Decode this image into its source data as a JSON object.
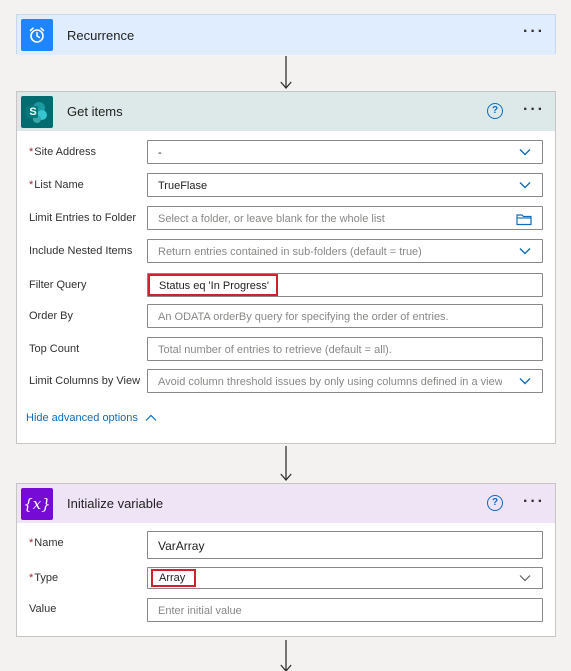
{
  "recurrence": {
    "title": "Recurrence",
    "more": "···"
  },
  "get_items": {
    "title": "Get items",
    "help": "?",
    "more": "···",
    "icon_letter": "S",
    "fields": {
      "site_address": {
        "label": "Site Address",
        "value": "-"
      },
      "list_name": {
        "label": "List Name",
        "value": "TrueFlase"
      },
      "limit_entries": {
        "label": "Limit Entries to Folder",
        "placeholder": "Select a folder, or leave blank for the whole list"
      },
      "include_nested": {
        "label": "Include Nested Items",
        "placeholder": "Return entries contained in sub-folders (default = true)"
      },
      "filter_query": {
        "label": "Filter Query",
        "value": "Status eq 'In Progress'"
      },
      "order_by": {
        "label": "Order By",
        "placeholder": "An ODATA orderBy query for specifying the order of entries."
      },
      "top_count": {
        "label": "Top Count",
        "placeholder": "Total number of entries to retrieve (default = all)."
      },
      "limit_columns": {
        "label": "Limit Columns by View",
        "placeholder": "Avoid column threshold issues by only using columns defined in a view"
      }
    },
    "hide_advanced": "Hide advanced options"
  },
  "init_var": {
    "title": "Initialize variable",
    "help": "?",
    "more": "···",
    "icon_text": "{x}",
    "fields": {
      "name": {
        "label": "Name",
        "value": "VarArray"
      },
      "type": {
        "label": "Type",
        "value": "Array"
      },
      "value": {
        "label": "Value",
        "placeholder": "Enter initial value"
      }
    }
  },
  "colors": {
    "recurrence_header": "#dfedff",
    "recurrence_icon": "#1f85ff",
    "get_items_header": "#dde9e8",
    "sharepoint": "#036c70",
    "variable_header": "#efe3f6",
    "variable_icon": "#770bd6",
    "link": "#0f6cbd",
    "highlight": "#d1212a"
  }
}
